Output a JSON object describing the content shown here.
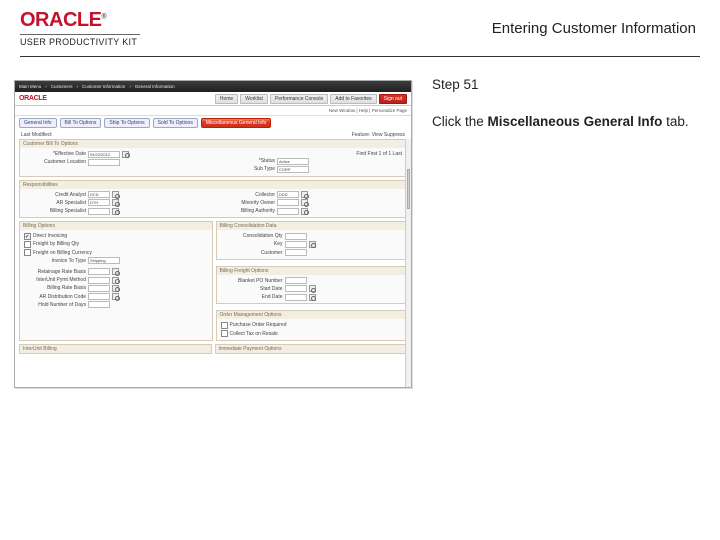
{
  "header": {
    "brand": "ORACLE",
    "brand_trademark": "®",
    "kit": "USER PRODUCTIVITY KIT",
    "title": "Entering Customer Information"
  },
  "instruction": {
    "step_label": "Step 51",
    "before": "Click the ",
    "bold": "Miscellaneous General Info",
    "after": " tab."
  },
  "screenshot": {
    "breadcrumbs": [
      "Main Menu",
      "Customers",
      "Customer Information",
      "General Information"
    ],
    "brand": "ORACLE",
    "nav": [
      "Home",
      "Worklist",
      "Performance Console",
      "Add to Favorites",
      "Sign out"
    ],
    "nav_active_index": 4,
    "userline": "New Window | Help | Personalize Page",
    "tabs": [
      "General Info",
      "Bill To Options",
      "Ship To Options",
      "Sold To Options",
      "Miscellaneous General Info"
    ],
    "tab_target_index": 4,
    "title_left": "Last Modified:",
    "title_right": "Feature: View Suppress",
    "top_panel": {
      "header": "Customer Bill To Options",
      "left_fields": [
        {
          "label": "*Effective Date",
          "value": "04/22/2012"
        },
        {
          "label": "Customer Location"
        }
      ],
      "right_text": "Find First 1 of 1 Last",
      "right_fields": [
        {
          "label": "*Status",
          "value": "Active"
        },
        {
          "label": "Sub Type",
          "value": "CORP"
        }
      ]
    },
    "responsibilities": {
      "header": "Responsibilities",
      "left": [
        {
          "label": "Credit Analyst",
          "value": "DCD"
        },
        {
          "label": "AR Specialist",
          "value": "DTH"
        },
        {
          "label": "Billing Specialist"
        }
      ],
      "right": [
        {
          "label": "Collector",
          "value": "DDD"
        },
        {
          "label": "Minority Owner"
        },
        {
          "label": "Billing Authority"
        }
      ]
    },
    "billing_options": {
      "left_header": "Billing Options",
      "right_header": "Billing Consolidation Data",
      "left_checks": [
        {
          "label": "Direct Invoicing",
          "checked": true
        },
        {
          "label": "Freight by Billing Qty",
          "checked": false
        },
        {
          "label": "Freight on Billing Currency",
          "checked": false
        }
      ],
      "left_fields": [
        {
          "label": "Invoice To Type",
          "value": "Shipping"
        }
      ],
      "left_fields2": [
        {
          "label": "Retainage Rate Basis"
        },
        {
          "label": "InterUnit Pymt Method"
        },
        {
          "label": "Billing Rate Basis"
        },
        {
          "label": "AR Distribution Code"
        },
        {
          "label": "Hold Number of Days"
        }
      ],
      "right_fields": [
        {
          "label": "Consolidation Qty"
        },
        {
          "label": "Key"
        },
        {
          "label": "Customer"
        }
      ],
      "freight_header": "Billing Freight Options",
      "freight_fields": [
        {
          "label": "Blanket PO Number"
        },
        {
          "label": "Start Date"
        },
        {
          "label": "End Date"
        }
      ],
      "order_header": "Order Management Options",
      "order_checks": [
        {
          "label": "Purchase Order Required",
          "checked": false
        },
        {
          "label": "Collect Tax on Resale",
          "checked": false
        }
      ]
    },
    "bottom_left": "InterUnit Billing",
    "bottom_right": "Immediate Payment Options"
  }
}
